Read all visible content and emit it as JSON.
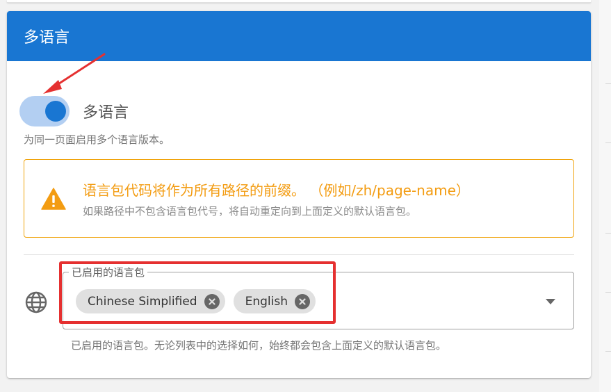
{
  "card": {
    "title": "多语言"
  },
  "multilang": {
    "toggle_label": "多语言",
    "enabled": true,
    "hint": "为同一页面启用多个语言版本。"
  },
  "alert": {
    "icon": "warning-icon",
    "title": "语言包代码将作为所有路径的前缀。 （例如/zh/page-name）",
    "subtitle": "如果路径中不包含语言包代号，将自动重定向到上面定义的默认语言包。"
  },
  "enabled_packs": {
    "icon": "globe-icon",
    "label": "已启用的语言包",
    "chips": [
      {
        "label": "Chinese Simplified"
      },
      {
        "label": "English"
      }
    ],
    "hint": "已启用的语言包。无论列表中的选择如何，始终都会包含上面定义的默认语言包。"
  },
  "colors": {
    "header": "#1976d2",
    "accent": "#1976d2",
    "warning": "#f39c12",
    "annotation": "#e53030"
  }
}
